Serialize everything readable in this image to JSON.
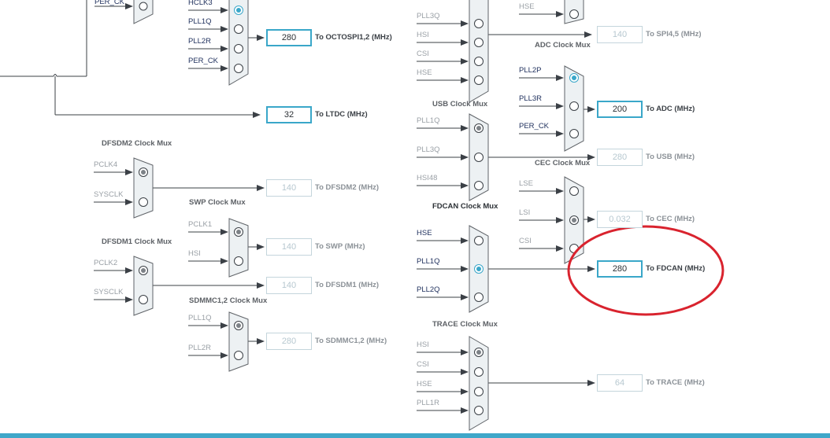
{
  "colors": {
    "highlight": "#d9232e",
    "accent": "#3aa7c9",
    "bottom_bar": "#3fa7c9"
  },
  "muxes": [
    {
      "id": "octospi-top",
      "title": "",
      "title_dark": false,
      "sel": 1,
      "inputs": [
        {
          "label": "PER_CK",
          "active": true
        },
        {
          "label": "HCLK3",
          "active": true
        },
        {
          "label": "PLL1Q",
          "active": true
        },
        {
          "label": "PLL2R",
          "active": true
        },
        {
          "label": "PER_CK",
          "active": true
        }
      ]
    },
    {
      "id": "dfsdm2",
      "title": "DFSDM2 Clock Mux",
      "title_dark": false,
      "sel": 0,
      "inputs": [
        {
          "label": "PCLK4",
          "active": false
        },
        {
          "label": "SYSCLK",
          "active": false
        }
      ]
    },
    {
      "id": "swp",
      "title": "SWP Clock Mux",
      "title_dark": false,
      "sel": 0,
      "inputs": [
        {
          "label": "PCLK1",
          "active": false
        },
        {
          "label": "HSI",
          "active": false
        }
      ]
    },
    {
      "id": "dfsdm1",
      "title": "DFSDM1 Clock Mux",
      "title_dark": false,
      "sel": 0,
      "inputs": [
        {
          "label": "PCLK2",
          "active": false
        },
        {
          "label": "SYSCLK",
          "active": false
        }
      ]
    },
    {
      "id": "sdmmc",
      "title": "SDMMC1,2 Clock Mux",
      "title_dark": false,
      "sel": 0,
      "inputs": [
        {
          "label": "PLL1Q",
          "active": false
        },
        {
          "label": "PLL2R",
          "active": false
        }
      ]
    },
    {
      "id": "spi-top",
      "title": "",
      "title_dark": false,
      "sel": -1,
      "inputs": [
        {
          "label": "PLL3Q",
          "active": false
        },
        {
          "label": "HSI",
          "active": false
        },
        {
          "label": "CSI",
          "active": false
        },
        {
          "label": "HSE",
          "active": false
        }
      ]
    },
    {
      "id": "spi45",
      "title": "",
      "title_dark": false,
      "sel": -1,
      "inputs": [
        {
          "label": "HSE",
          "active": false
        }
      ]
    },
    {
      "id": "adc",
      "title": "ADC Clock Mux",
      "title_dark": false,
      "sel": 0,
      "inputs": [
        {
          "label": "PLL2P",
          "active": true
        },
        {
          "label": "PLL3R",
          "active": true
        },
        {
          "label": "PER_CK",
          "active": true
        }
      ]
    },
    {
      "id": "usb",
      "title": "USB Clock Mux",
      "title_dark": false,
      "sel": 0,
      "inputs": [
        {
          "label": "PLL1Q",
          "active": false
        },
        {
          "label": "PLL3Q",
          "active": false
        },
        {
          "label": "HSI48",
          "active": false
        }
      ]
    },
    {
      "id": "cec",
      "title": "CEC Clock Mux",
      "title_dark": false,
      "sel": 1,
      "inputs": [
        {
          "label": "LSE",
          "active": false
        },
        {
          "label": "LSI",
          "active": false
        },
        {
          "label": "CSI",
          "active": false
        }
      ]
    },
    {
      "id": "fdcan",
      "title": "FDCAN Clock Mux",
      "title_dark": true,
      "sel": 1,
      "inputs": [
        {
          "label": "HSE",
          "active": true
        },
        {
          "label": "PLL1Q",
          "active": true
        },
        {
          "label": "PLL2Q",
          "active": true
        }
      ]
    },
    {
      "id": "trace",
      "title": "TRACE Clock Mux",
      "title_dark": false,
      "sel": 0,
      "inputs": [
        {
          "label": "HSI",
          "active": false
        },
        {
          "label": "CSI",
          "active": false
        },
        {
          "label": "HSE",
          "active": false
        },
        {
          "label": "PLL1R",
          "active": false
        }
      ]
    }
  ],
  "outputs": [
    {
      "id": "octospi",
      "value": "280",
      "label": "To OCTOSPI1,2 (MHz)",
      "active": true
    },
    {
      "id": "ltdc",
      "value": "32",
      "label": "To LTDC (MHz)",
      "active": true
    },
    {
      "id": "dfsdm2",
      "value": "140",
      "label": "To DFSDM2 (MHz)",
      "active": false
    },
    {
      "id": "swp",
      "value": "140",
      "label": "To SWP (MHz)",
      "active": false
    },
    {
      "id": "dfsdm1",
      "value": "140",
      "label": "To DFSDM1 (MHz)",
      "active": false
    },
    {
      "id": "sdmmc",
      "value": "280",
      "label": "To SDMMC1,2 (MHz)",
      "active": false
    },
    {
      "id": "spi45",
      "value": "140",
      "label": "To SPI4,5 (MHz)",
      "active": false
    },
    {
      "id": "adc",
      "value": "200",
      "label": "To ADC (MHz)",
      "active": true
    },
    {
      "id": "usb",
      "value": "280",
      "label": "To USB (MHz)",
      "active": false
    },
    {
      "id": "cec",
      "value": "0.032",
      "label": "To CEC (MHz)",
      "active": false
    },
    {
      "id": "fdcan",
      "value": "280",
      "label": "To FDCAN (MHz)",
      "active": true
    },
    {
      "id": "trace",
      "value": "64",
      "label": "To TRACE (MHz)",
      "active": false
    }
  ]
}
